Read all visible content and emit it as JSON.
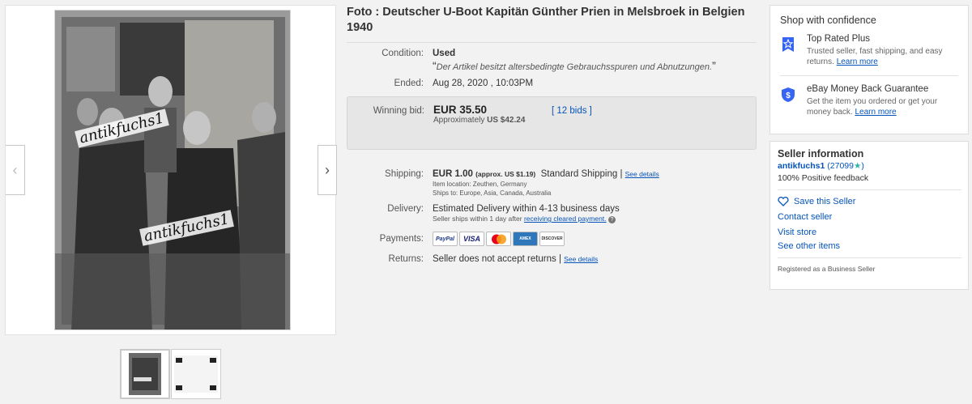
{
  "gallery": {
    "prev_arrow": "‹",
    "next_arrow": "›",
    "watermark": "antikfuchs1"
  },
  "listing": {
    "title": "Foto : Deutscher U-Boot Kapitän Günther Prien in Melsbroek in Belgien 1940",
    "condition_label": "Condition:",
    "condition_value": "Used",
    "condition_note": "Der Artikel besitzt altersbedingte Gebrauchsspuren und Abnutzungen.",
    "ended_label": "Ended:",
    "ended_value": "Aug 28, 2020 , 10:03PM",
    "winning_label": "Winning bid:",
    "winning_value": "EUR 35.50",
    "approx_prefix": "Approximately",
    "approx_value": "US $42.24",
    "bids_link": "12 bids",
    "shipping_label": "Shipping:",
    "shipping_value": "EUR 1.00",
    "shipping_approx": "(approx. US $1.19)",
    "shipping_method": "Standard Shipping |",
    "shipping_see": "See details",
    "item_location": "Item location:  Zeuthen, Germany",
    "ships_to": "Ships to:  Europe, Asia, Canada, Australia",
    "delivery_label": "Delivery:",
    "delivery_value": "Estimated Delivery within 4-13 business days",
    "delivery_note": "Seller ships within 1 day after",
    "delivery_link": "receiving cleared payment.",
    "payments_label": "Payments:",
    "payment_methods": [
      "PayPal",
      "VISA",
      "MasterCard",
      "AMEX",
      "DISCOVER"
    ],
    "returns_label": "Returns:",
    "returns_value": "Seller does not accept returns |",
    "returns_see": "See details"
  },
  "confidence": {
    "title": "Shop with confidence",
    "top_rated_title": "Top Rated Plus",
    "top_rated_desc": "Trusted seller, fast shipping, and easy returns.",
    "top_rated_link": "Learn more",
    "mbg_title": "eBay Money Back Guarantee",
    "mbg_desc": "Get the item you ordered or get your money back.",
    "mbg_link": "Learn more"
  },
  "seller": {
    "title": "Seller information",
    "name": "antikfuchs1",
    "feedback_count": "(27099",
    "feedback_close": ")",
    "positive": "100% Positive feedback",
    "save": "Save this Seller",
    "contact": "Contact seller",
    "store": "Visit store",
    "other_items": "See other items",
    "registered": "Registered as a Business Seller"
  },
  "colors": {
    "link": "#0654ba",
    "star_teal": "#2fb5a7",
    "shield_blue": "#3665f3"
  }
}
